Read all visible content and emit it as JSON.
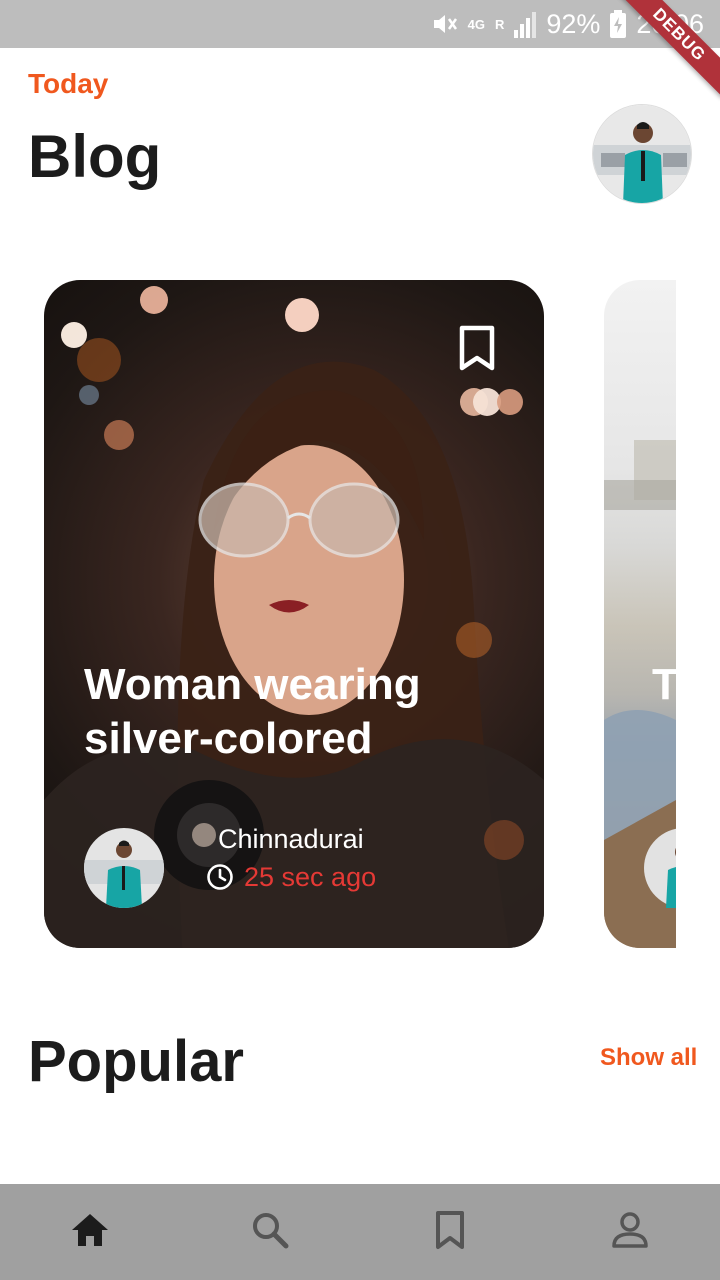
{
  "status_bar": {
    "battery_percent": "92%",
    "time": "20:06",
    "network": "4G",
    "roaming": "R",
    "debug_banner": "DEBUG",
    "icons": [
      "mute-icon",
      "signal-icon",
      "battery-icon"
    ]
  },
  "header": {
    "subtitle": "Today",
    "title": "Blog"
  },
  "carousel": {
    "cards": [
      {
        "title": "Woman wearing silver-colored",
        "author": "Chinnadurai",
        "time_ago": "25 sec ago",
        "bookmark_icon": "bookmark-outline-icon"
      },
      {
        "title_fragment": "T"
      }
    ]
  },
  "popular": {
    "title": "Popular",
    "show_all_label": "Show all"
  },
  "bottom_nav": {
    "items": [
      {
        "icon": "home-icon",
        "active": true
      },
      {
        "icon": "search-icon",
        "active": false
      },
      {
        "icon": "bookmark-icon",
        "active": false
      },
      {
        "icon": "person-icon",
        "active": false
      }
    ]
  },
  "colors": {
    "accent": "#f0581e",
    "time_ago": "#e53935",
    "status_bar": "#bdbdbd",
    "bottom_nav": "#a0a0a0",
    "nav_active": "#1c1c1c",
    "nav_inactive": "#555555"
  }
}
